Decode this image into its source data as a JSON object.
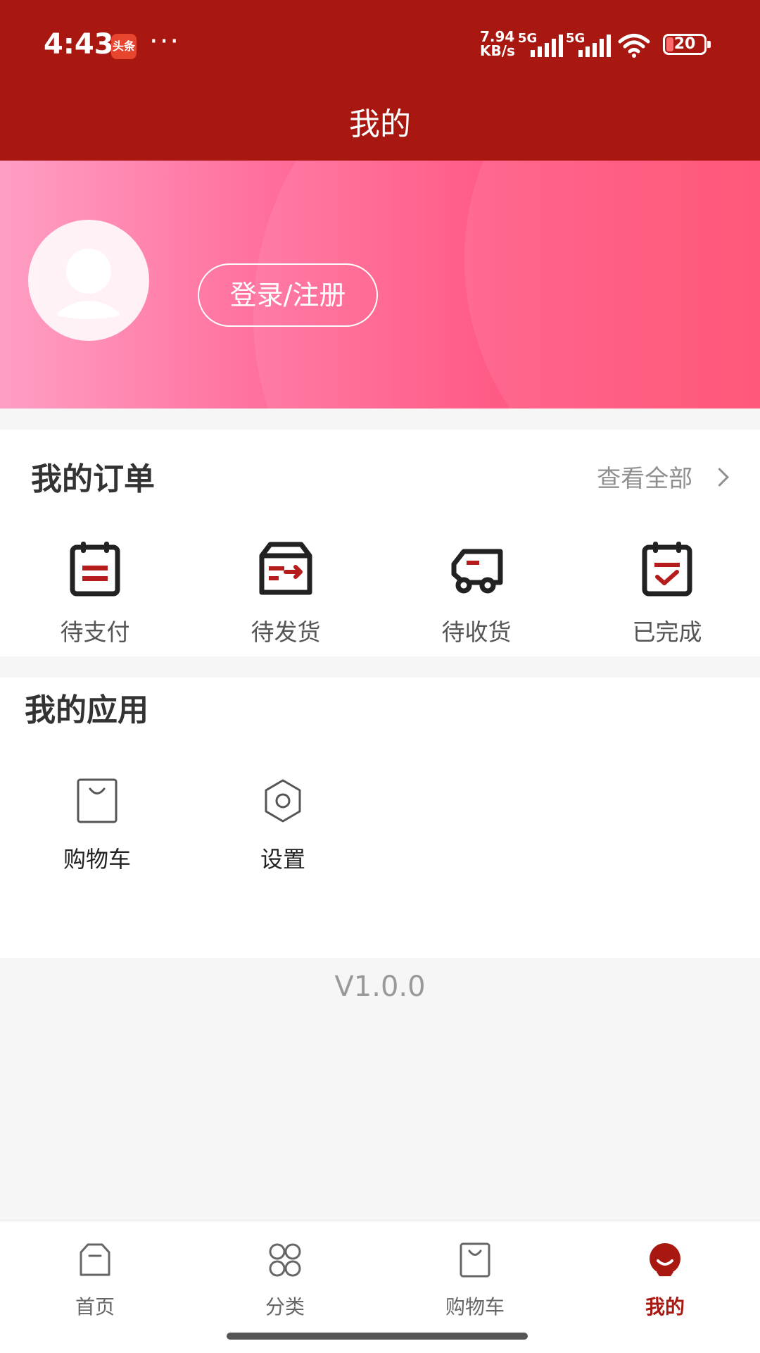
{
  "status_bar": {
    "time": "4:43",
    "app_badge": "头条",
    "dots": "···",
    "speed_value": "7.94",
    "speed_unit": "KB/s",
    "network_1": "5G",
    "network_2": "5G",
    "battery": "20",
    "colors": {
      "bg": "#a81810",
      "fg": "#ffffff"
    }
  },
  "header": {
    "title": "我的"
  },
  "profile": {
    "login_button": "登录/注册"
  },
  "orders": {
    "title": "我的订单",
    "view_all": "查看全部",
    "items": [
      {
        "label": "待支付",
        "icon": "pending-payment-icon"
      },
      {
        "label": "待发货",
        "icon": "pending-shipment-icon"
      },
      {
        "label": "待收货",
        "icon": "delivery-truck-icon"
      },
      {
        "label": "已完成",
        "icon": "completed-calendar-icon"
      }
    ]
  },
  "apps": {
    "title": "我的应用",
    "items": [
      {
        "label": "购物车",
        "icon": "shopping-bag-icon"
      },
      {
        "label": "设置",
        "icon": "settings-icon"
      }
    ]
  },
  "footer": {
    "version": "V1.0.0"
  },
  "tabbar": {
    "items": [
      {
        "label": "首页",
        "icon": "home-icon"
      },
      {
        "label": "分类",
        "icon": "category-icon"
      },
      {
        "label": "购物车",
        "icon": "cart-icon"
      },
      {
        "label": "我的",
        "icon": "profile-icon",
        "active": true
      }
    ],
    "active_color": "#a81810"
  }
}
